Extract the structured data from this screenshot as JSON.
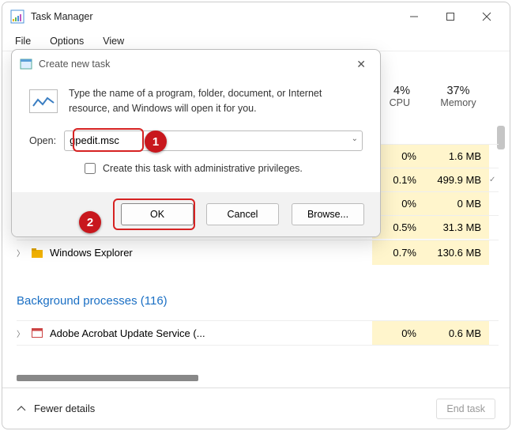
{
  "window": {
    "title": "Task Manager"
  },
  "menu": {
    "file": "File",
    "options": "Options",
    "view": "View"
  },
  "columns": {
    "cpu_pct": "4%",
    "cpu_label": "CPU",
    "mem_pct": "37%",
    "mem_label": "Memory"
  },
  "rows": [
    {
      "cpu": "0%",
      "mem": "1.6 MB"
    },
    {
      "cpu": "0.1%",
      "mem": "499.9 MB"
    },
    {
      "cpu": "0%",
      "mem": "0 MB"
    },
    {
      "cpu": "0.5%",
      "mem": "31.3 MB"
    }
  ],
  "explorer": {
    "name": "Windows Explorer",
    "cpu": "0.7%",
    "mem": "130.6 MB"
  },
  "bg_heading": "Background processes (116)",
  "acrobat": {
    "name": "Adobe Acrobat Update Service (...",
    "cpu": "0%",
    "mem": "0.6 MB"
  },
  "footer": {
    "fewer": "Fewer details",
    "end": "End task"
  },
  "dialog": {
    "title": "Create new task",
    "message": "Type the name of a program, folder, document, or Internet resource, and Windows will open it for you.",
    "open_label": "Open:",
    "value": "gpedit.msc",
    "admin": "Create this task with administrative privileges.",
    "ok": "OK",
    "cancel": "Cancel",
    "browse": "Browse..."
  },
  "callouts": {
    "one": "1",
    "two": "2"
  }
}
